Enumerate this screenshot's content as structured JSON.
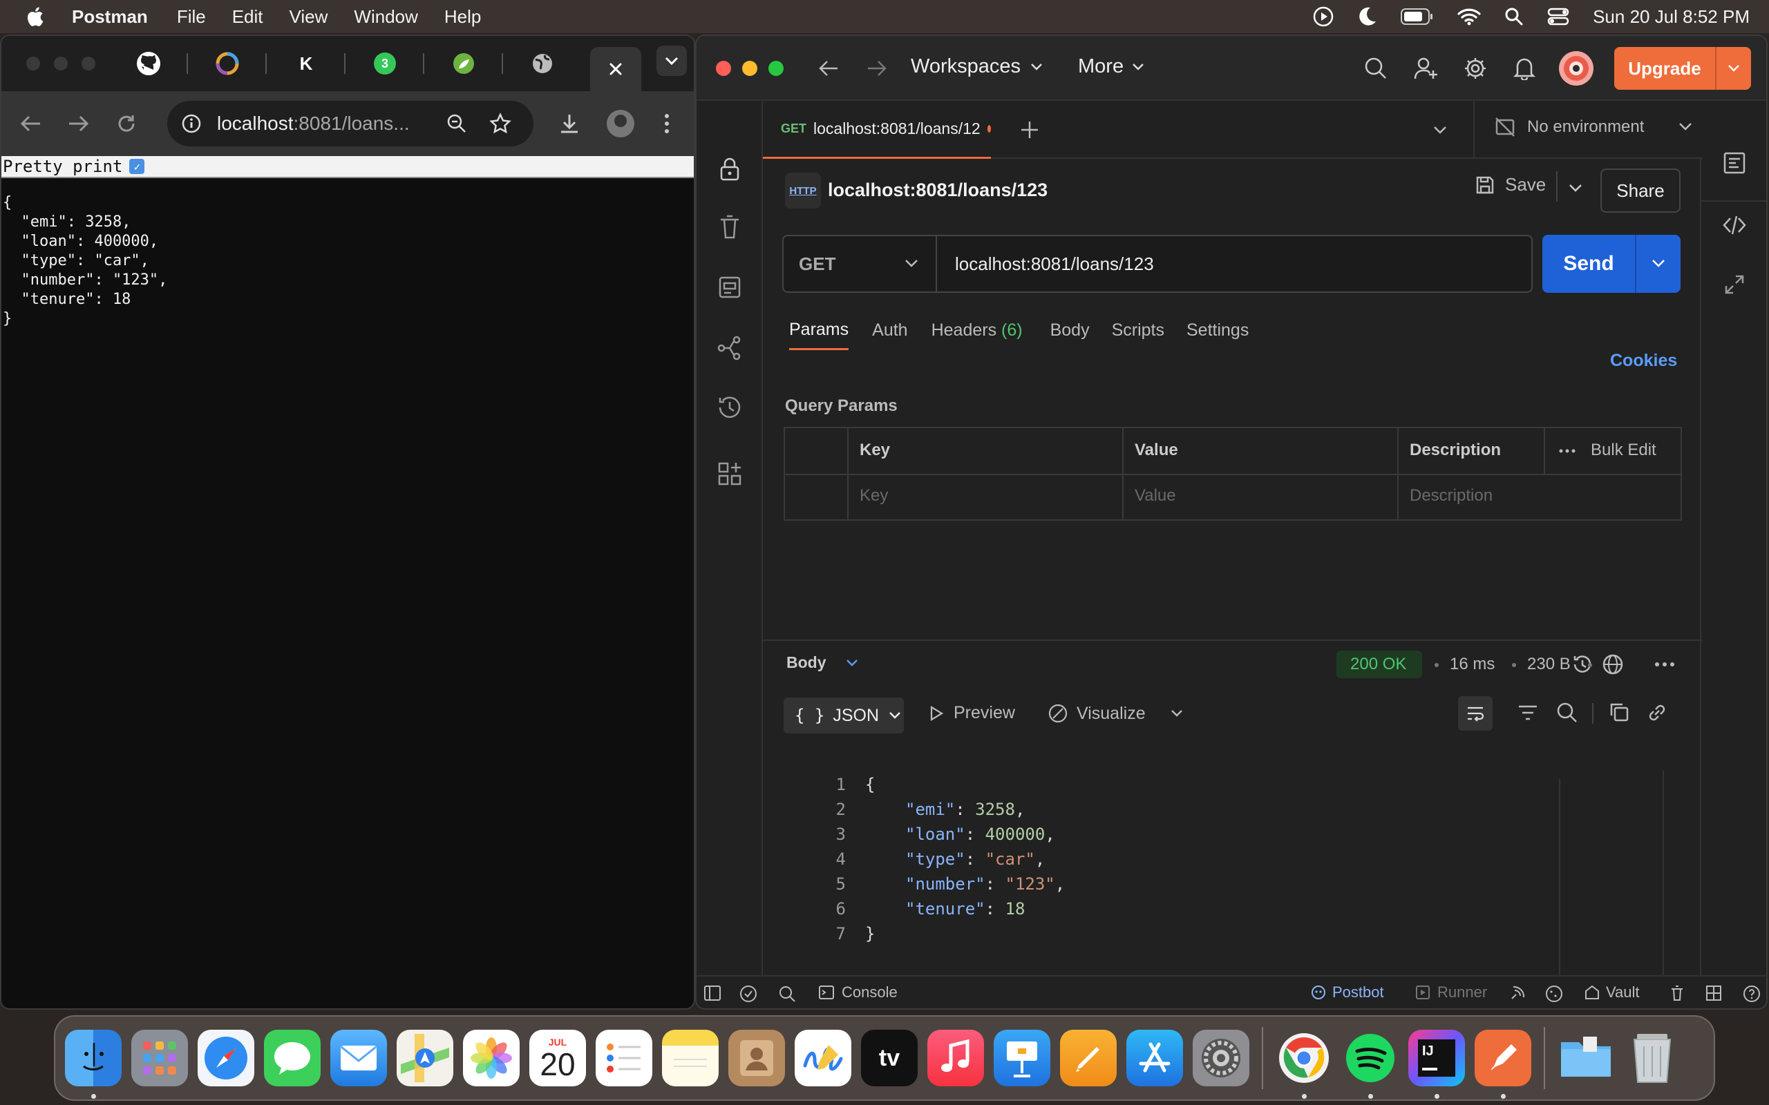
{
  "menubar": {
    "app_name": "Postman",
    "items": [
      "File",
      "Edit",
      "View",
      "Window",
      "Help"
    ],
    "clock": "Sun 20 Jul  8:52 PM"
  },
  "browser": {
    "address_host": "localhost",
    "address_rest": ":8081/loans...",
    "tab_badge": "3",
    "tab_k": "K",
    "pretty_print_label": "Pretty print",
    "pretty_print_checked": true,
    "raw_json": "{\n  \"emi\": 3258,\n  \"loan\": 400000,\n  \"type\": \"car\",\n  \"number\": \"123\",\n  \"tenure\": 18\n}"
  },
  "postman": {
    "workspaces_label": "Workspaces",
    "more_label": "More",
    "upgrade_label": "Upgrade",
    "tab_method": "GET",
    "tab_title": "localhost:8081/loans/12",
    "environment": "No environment",
    "request_name": "localhost:8081/loans/123",
    "http_badge": "HTTP",
    "save_label": "Save",
    "share_label": "Share",
    "method": "GET",
    "url": "localhost:8081/loans/123",
    "send_label": "Send",
    "req_tabs": [
      "Params",
      "Auth",
      "Headers",
      "Body",
      "Scripts",
      "Settings"
    ],
    "headers_count": "(6)",
    "cookies_label": "Cookies",
    "query_params_title": "Query Params",
    "table": {
      "headers": [
        "Key",
        "Value",
        "Description"
      ],
      "bulk_edit": "Bulk Edit",
      "placeholders": [
        "Key",
        "Value",
        "Description"
      ]
    },
    "response": {
      "body_label": "Body",
      "status": "200 OK",
      "time": "16 ms",
      "size": "230 B",
      "format": "JSON",
      "preview_label": "Preview",
      "visualize_label": "Visualize",
      "lines": [
        {
          "n": "1",
          "text": "{"
        },
        {
          "n": "2",
          "key": "\"emi\"",
          "value": "3258",
          "kind": "num",
          "comma": ","
        },
        {
          "n": "3",
          "key": "\"loan\"",
          "value": "400000",
          "kind": "num",
          "comma": ","
        },
        {
          "n": "4",
          "key": "\"type\"",
          "value": "\"car\"",
          "kind": "str",
          "comma": ","
        },
        {
          "n": "5",
          "key": "\"number\"",
          "value": "\"123\"",
          "kind": "str",
          "comma": ","
        },
        {
          "n": "6",
          "key": "\"tenure\"",
          "value": "18",
          "kind": "num",
          "comma": ""
        },
        {
          "n": "7",
          "text": "}"
        }
      ]
    },
    "footer": {
      "console_label": "Console",
      "postbot_label": "Postbot",
      "runner_label": "Runner",
      "vault_label": "Vault"
    }
  },
  "dock": {
    "calendar_month": "JUL",
    "calendar_day": "20",
    "tv_label": "tv",
    "intellij_label": "IJ"
  },
  "colors": {
    "postman_orange": "#ef6c3b",
    "send_blue": "#1f62d8",
    "status_green": "#4fc56f",
    "json_key": "#8ab4f8",
    "json_number": "#b5cea8",
    "json_string": "#ce9178"
  }
}
